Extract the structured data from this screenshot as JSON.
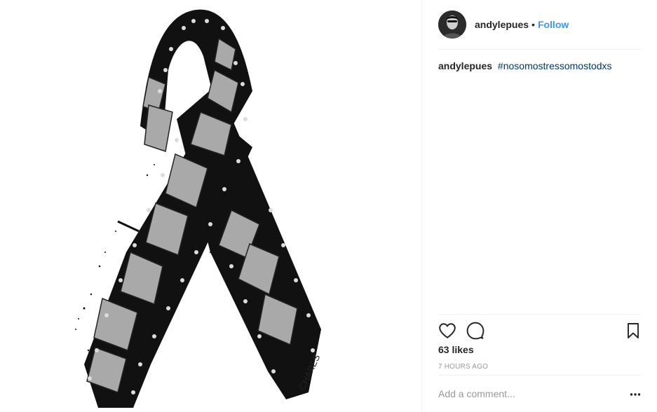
{
  "post": {
    "username": "andylepues",
    "separator": "•",
    "follow_label": "Follow",
    "caption": {
      "username": "andylepues",
      "hashtag": "#nosomostressomostodxs"
    },
    "likes": "63 likes",
    "timestamp": "7 HOURS AGO",
    "comment_placeholder": "Add a comment...",
    "artist_signature": "CHARES"
  },
  "icons": {
    "like": "heart-icon",
    "comment": "comment-bubble-icon",
    "save": "bookmark-icon",
    "more": "more-options-icon"
  },
  "colors": {
    "link": "#3897f0",
    "hashtag": "#003569",
    "muted": "#999999",
    "text": "#262626"
  }
}
